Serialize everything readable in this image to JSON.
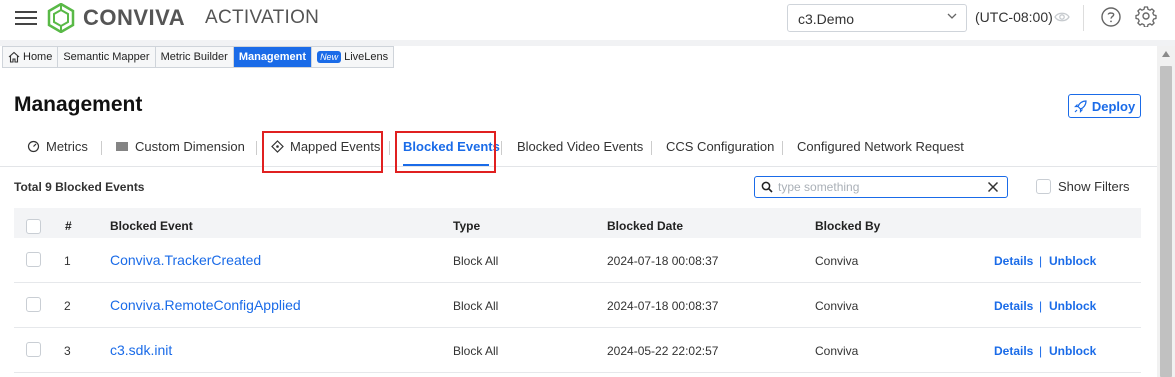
{
  "brand": {
    "name": "CONVIVA",
    "product": "ACTIVATION"
  },
  "header": {
    "account": "c3.Demo",
    "timezone": "(UTC-08:00)"
  },
  "breadcrumbs": {
    "home": "Home",
    "semantic_mapper": "Semantic Mapper",
    "metric_builder": "Metric Builder",
    "management": "Management",
    "new_badge": "New",
    "livelens": "LiveLens"
  },
  "page": {
    "title": "Management",
    "deploy_label": "Deploy"
  },
  "tabs": {
    "metrics": "Metrics",
    "custom_dimension": "Custom Dimension",
    "mapped_events": "Mapped Events",
    "blocked_events": "Blocked Events",
    "blocked_video_events": "Blocked Video Events",
    "ccs_configuration": "CCS Configuration",
    "configured_network_request": "Configured Network Request"
  },
  "toolbar": {
    "total_label": "Total 9 Blocked Events",
    "search_placeholder": "type something",
    "show_filters": "Show Filters"
  },
  "table": {
    "columns": [
      "#",
      "Blocked Event",
      "Type",
      "Blocked Date",
      "Blocked By"
    ],
    "rows": [
      {
        "num": "1",
        "event": "Conviva.TrackerCreated",
        "type": "Block All",
        "date": "2024-07-18 00:08:37",
        "by": "Conviva",
        "details": "Details",
        "unblock": "Unblock"
      },
      {
        "num": "2",
        "event": "Conviva.RemoteConfigApplied",
        "type": "Block All",
        "date": "2024-07-18 00:08:37",
        "by": "Conviva",
        "details": "Details",
        "unblock": "Unblock"
      },
      {
        "num": "3",
        "event": "c3.sdk.init",
        "type": "Block All",
        "date": "2024-05-22 22:02:57",
        "by": "Conviva",
        "details": "Details",
        "unblock": "Unblock"
      }
    ]
  },
  "colors": {
    "accent": "#1a6be8",
    "highlight": "#e02020",
    "logo": "#59b947"
  }
}
